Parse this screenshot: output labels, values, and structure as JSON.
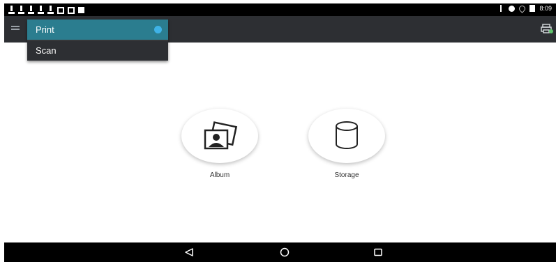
{
  "status_bar": {
    "notification_icons": [
      "download-icon",
      "download-icon",
      "download-icon",
      "download-icon",
      "download-icon",
      "image-icon",
      "calendar-icon",
      "info-icon"
    ],
    "system_icons": [
      "bluetooth-icon",
      "alarm-icon",
      "wifi-icon",
      "battery-icon"
    ],
    "time": "8:09"
  },
  "app_bar": {
    "menu_icon": "hamburger-icon",
    "action_icon": "printer-icon"
  },
  "mode_dropdown": {
    "items": [
      {
        "label": "Print",
        "selected": true
      },
      {
        "label": "Scan",
        "selected": false
      }
    ]
  },
  "tiles": {
    "album": {
      "label": "Album",
      "icon": "photo-album-icon"
    },
    "storage": {
      "label": "Storage",
      "icon": "storage-icon"
    }
  },
  "nav_bar": {
    "buttons": [
      "back-icon",
      "home-icon",
      "recents-icon"
    ]
  },
  "colors": {
    "app_bar": "#2d2f33",
    "selected_item": "#2b7d8f",
    "selected_indicator": "#3fb2e6",
    "status_bar": "#000000"
  }
}
